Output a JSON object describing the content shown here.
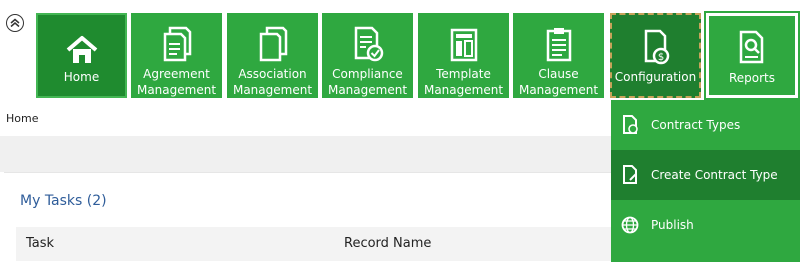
{
  "nav": {
    "tiles": [
      {
        "label": "Home",
        "icon": "home-icon"
      },
      {
        "label": "Agreement Management",
        "icon": "agreement-document-icon"
      },
      {
        "label": "Association Management",
        "icon": "association-document-icon"
      },
      {
        "label": "Compliance Management",
        "icon": "compliance-document-icon"
      },
      {
        "label": "Template Management",
        "icon": "template-icon"
      },
      {
        "label": "Clause Management",
        "icon": "clipboard-icon"
      },
      {
        "label": "Configuration",
        "icon": "configuration-document-icon"
      },
      {
        "label": "Reports",
        "icon": "reports-search-icon"
      }
    ]
  },
  "dropdown": {
    "items": [
      {
        "label": "Contract Types",
        "icon": "contract-types-icon"
      },
      {
        "label": "Create Contract Type",
        "icon": "create-contract-type-icon"
      },
      {
        "label": "Publish",
        "icon": "publish-globe-icon"
      }
    ]
  },
  "breadcrumb": "Home",
  "tasks": {
    "title": "My Tasks (2)",
    "columns": [
      "Task",
      "Record Name"
    ]
  },
  "colors": {
    "tile_green": "#2fa840",
    "tile_dark_green": "#1f7f2f",
    "title_blue": "#2f5d9a"
  }
}
